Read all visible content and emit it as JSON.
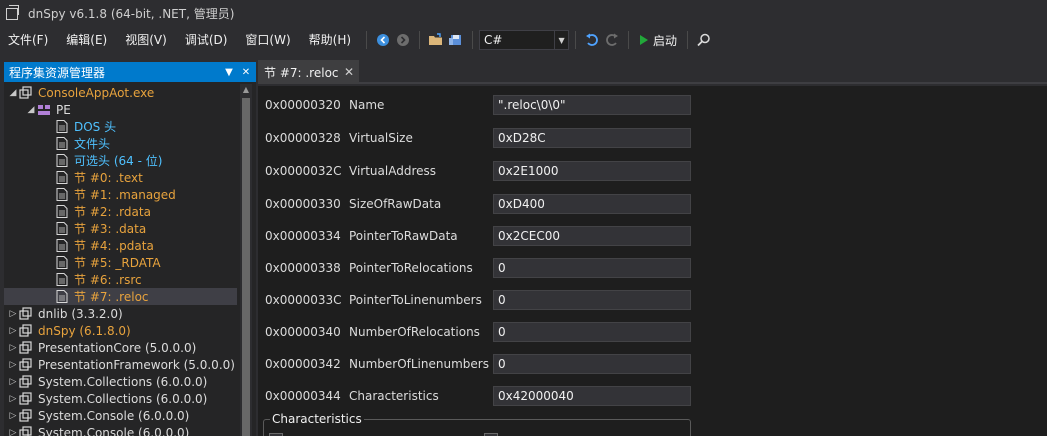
{
  "window": {
    "title": "dnSpy v6.1.8 (64-bit, .NET, 管理员)"
  },
  "menu": [
    "文件(F)",
    "编辑(E)",
    "视图(V)",
    "调试(D)",
    "窗口(W)",
    "帮助(H)"
  ],
  "toolbar": {
    "language": "C#",
    "start_label": "启动"
  },
  "explorer": {
    "title": "程序集资源管理器",
    "nodes": [
      {
        "label": "ConsoleAppAot.exe",
        "expander": "◢",
        "icon": "assembly-icon",
        "color": "#e8a33d"
      },
      {
        "label": "PE",
        "expander": "◢",
        "icon": "pe-module-icon",
        "color": "#dcdcdc"
      },
      {
        "label": "DOS 头",
        "icon": "document-icon",
        "color": "#4fc1ff"
      },
      {
        "label": "文件头",
        "icon": "document-icon",
        "color": "#4fc1ff"
      },
      {
        "label": "可选头 (64 - 位)",
        "icon": "document-icon",
        "color": "#4fc1ff"
      },
      {
        "label": "节 #0: .text",
        "icon": "document-icon",
        "color": "#e8a33d"
      },
      {
        "label": "节 #1: .managed",
        "icon": "document-icon",
        "color": "#e8a33d"
      },
      {
        "label": "节 #2: .rdata",
        "icon": "document-icon",
        "color": "#e8a33d"
      },
      {
        "label": "节 #3: .data",
        "icon": "document-icon",
        "color": "#e8a33d"
      },
      {
        "label": "节 #4: .pdata",
        "icon": "document-icon",
        "color": "#e8a33d"
      },
      {
        "label": "节 #5: _RDATA",
        "icon": "document-icon",
        "color": "#e8a33d"
      },
      {
        "label": "节 #6: .rsrc",
        "icon": "document-icon",
        "color": "#e8a33d"
      },
      {
        "label": "节 #7: .reloc",
        "icon": "document-icon",
        "color": "#e8a33d",
        "selected": true
      },
      {
        "label": "dnlib (3.3.2.0)",
        "expander": "▷",
        "icon": "assembly-icon",
        "color": "#dcdcdc"
      },
      {
        "label": "dnSpy (6.1.8.0)",
        "expander": "▷",
        "icon": "assembly-icon",
        "color": "#e8a33d"
      },
      {
        "label": "PresentationCore (5.0.0.0)",
        "expander": "▷",
        "icon": "assembly-icon",
        "color": "#dcdcdc"
      },
      {
        "label": "PresentationFramework (5.0.0.0)",
        "expander": "▷",
        "icon": "assembly-icon",
        "color": "#dcdcdc"
      },
      {
        "label": "System.Collections (6.0.0.0)",
        "expander": "▷",
        "icon": "assembly-icon",
        "color": "#dcdcdc"
      },
      {
        "label": "System.Collections (6.0.0.0)",
        "expander": "▷",
        "icon": "assembly-icon",
        "color": "#dcdcdc"
      },
      {
        "label": "System.Console (6.0.0.0)",
        "expander": "▷",
        "icon": "assembly-icon",
        "color": "#dcdcdc"
      },
      {
        "label": "System.Console (6.0.0.0)",
        "expander": "▷",
        "icon": "assembly-icon",
        "color": "#dcdcdc"
      }
    ]
  },
  "tab": {
    "label": "节 #7: .reloc",
    "close": "✕"
  },
  "fields": [
    {
      "offset": "0x00000320",
      "name": "Name",
      "value": "\".reloc\\0\\0\""
    },
    {
      "offset": "0x00000328",
      "name": "VirtualSize",
      "value": "0xD28C"
    },
    {
      "offset": "0x0000032C",
      "name": "VirtualAddress",
      "value": "0x2E1000"
    },
    {
      "offset": "0x00000330",
      "name": "SizeOfRawData",
      "value": "0xD400"
    },
    {
      "offset": "0x00000334",
      "name": "PointerToRawData",
      "value": "0x2CEC00"
    },
    {
      "offset": "0x00000338",
      "name": "PointerToRelocations",
      "value": "0"
    },
    {
      "offset": "0x0000033C",
      "name": "PointerToLinenumbers",
      "value": "0"
    },
    {
      "offset": "0x00000340",
      "name": "NumberOfRelocations",
      "value": "0"
    },
    {
      "offset": "0x00000342",
      "name": "NumberOfLinenumbers",
      "value": "0"
    },
    {
      "offset": "0x00000344",
      "name": "Characteristics",
      "value": "0x42000040"
    }
  ],
  "group": {
    "legend": "Characteristics"
  },
  "colors": {
    "accent": "#007acc",
    "orange_text": "#e8a33d",
    "blue_text": "#4fc1ff",
    "start_green": "#22a83a"
  }
}
